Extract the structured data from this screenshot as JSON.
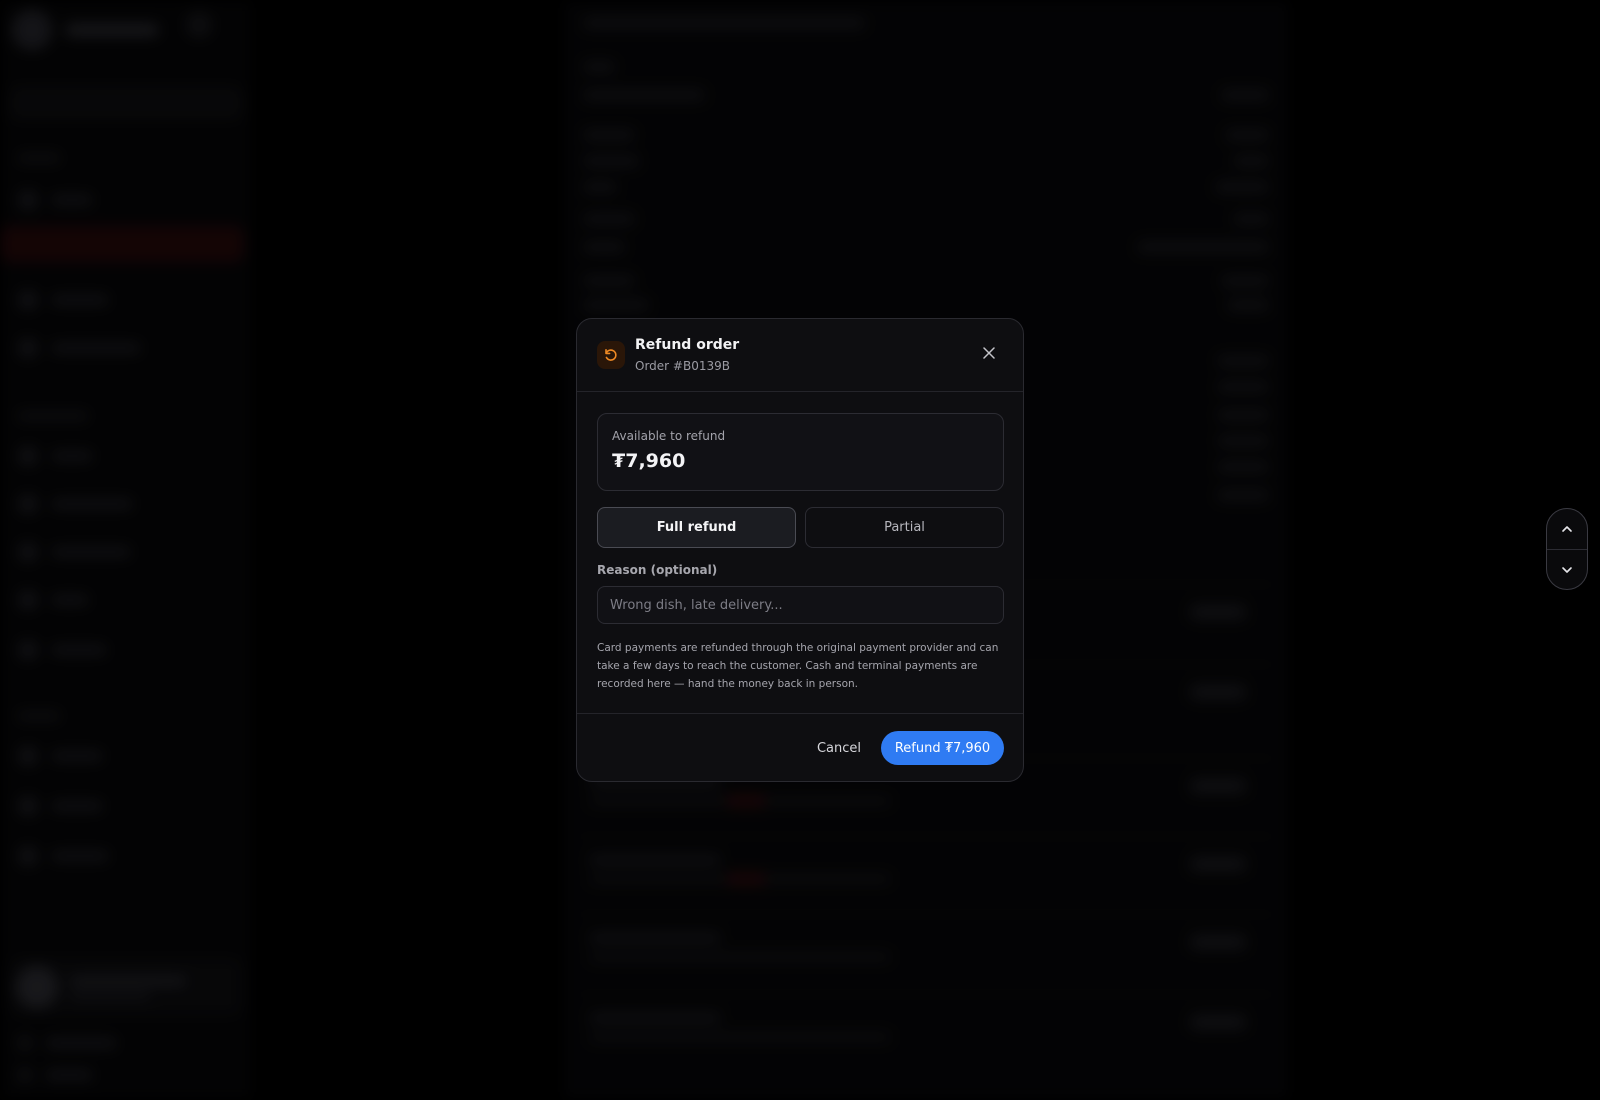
{
  "dialog": {
    "title": "Refund order",
    "subtitle": "Order #B0139B",
    "available_label": "Available to refund",
    "available_amount": "₮7,960",
    "options": {
      "full": "Full refund",
      "partial": "Partial",
      "selected": "full"
    },
    "reason_label": "Reason (optional)",
    "reason_placeholder": "Wrong dish, late delivery...",
    "reason_value": "",
    "info": "Card payments are refunded through the original payment provider and can take a few days to reach the customer. Cash and terminal payments are recorded here — hand the money back in person.",
    "cancel_label": "Cancel",
    "confirm_label": "Refund ₮7,960"
  },
  "icons": {
    "header": "refund-icon",
    "close": "close-icon",
    "scroll_up": "chevron-up-icon",
    "scroll_down": "chevron-down-icon"
  },
  "colors": {
    "primary": "#2f7bf3",
    "refund_icon": "#f08a24",
    "background": "#000000",
    "modal": "#0e0e11"
  }
}
